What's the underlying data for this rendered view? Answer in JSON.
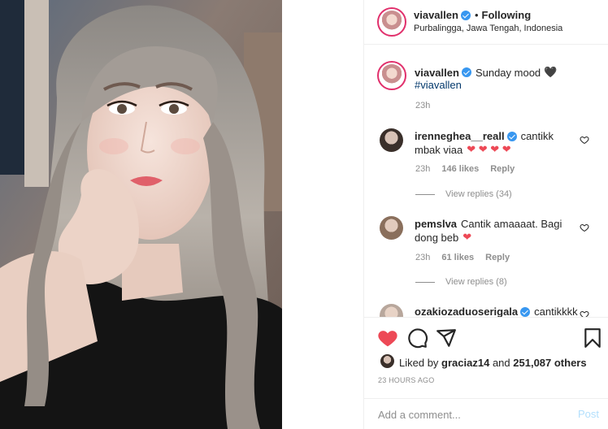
{
  "post": {
    "username": "viavallen",
    "dot": "•",
    "following_label": "Following",
    "location": "Purbalingga, Jawa Tengah, Indonesia",
    "caption": "Sunday mood",
    "caption_emoji": "🖤",
    "hashtag": "#viavallen",
    "caption_time": "23h"
  },
  "comments": [
    {
      "username": "irenneghea__reall",
      "text1": "cantikk",
      "text2": "mbak viaa",
      "hearts": "❤ ❤ ❤ ❤",
      "time": "23h",
      "likes": "146 likes",
      "reply": "Reply",
      "view_replies": "View replies (34)"
    },
    {
      "username": "pemslva",
      "text1": "Cantik amaaaat. Bagi",
      "text2": "dong beb",
      "hearts": "❤",
      "time": "23h",
      "likes": "61 likes",
      "reply": "Reply",
      "view_replies": "View replies (8)"
    },
    {
      "username": "ozakiozaduoserigala",
      "text1": "cantikkkk"
    }
  ],
  "liked_by": {
    "prefix": "Liked by",
    "user": "graciaz14",
    "mid": "and",
    "count": "251,087 others"
  },
  "time_ago": "23 HOURS AGO",
  "add_comment": {
    "placeholder": "Add a comment...",
    "post_label": "Post"
  },
  "colors": {
    "like_red": "#ed4956",
    "link_blue": "#00376b",
    "verified_blue": "#3897f0",
    "post_disabled": "#b2dffc"
  },
  "icons": {
    "verified": "verified-badge-icon",
    "like": "heart-filled-icon",
    "comment": "comment-bubble-icon",
    "share": "paper-plane-icon",
    "save": "bookmark-icon",
    "comment_like": "heart-outline-icon"
  }
}
